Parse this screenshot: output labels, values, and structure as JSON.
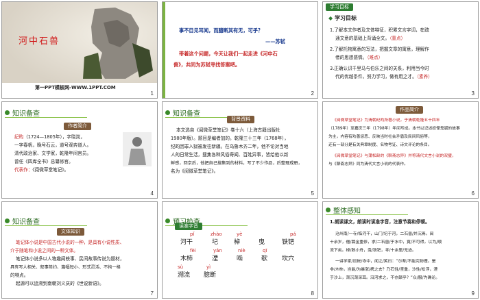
{
  "s1": {
    "title": "河中石兽",
    "footer": "第一PPT模板网-WWW.1PPT.COM",
    "num": "1"
  },
  "s2": {
    "quote": "事不目见耳闻，而臆断其有无，可乎？",
    "author": "——苏轼",
    "lead_a": "带着这个问题，今天让我们一起走进《河中石",
    "lead_b": "兽》，共同为苏轼寻找答案吧。",
    "num": "2"
  },
  "s3": {
    "tag": "学习目标",
    "head": "学习目标",
    "items": [
      {
        "n": "1.",
        "a": "了解本文作者及文体特征，积累文言字词，在疏",
        "b": "通文意的基础上背诵全文。",
        "em": "（重点）"
      },
      {
        "n": "2.",
        "a": "了解托物寓意的写法，把握文章的寓意，理解作",
        "b": "者的思想感情。",
        "em": "（难点）"
      },
      {
        "n": "3.",
        "a": "正确认识千里马与伯乐之间的关系，利用当今时",
        "b": "代的优越条件，努力学习，做有用之才。",
        "em": "（素养）"
      }
    ],
    "num": "3"
  },
  "s4": {
    "head": "知识备查",
    "tag": "作者简介",
    "name": "纪昀",
    "rest": "（1724—1805年），字晓岚，",
    "lines": [
      "一字春帆，晚号石云，道号观弈道人。",
      "清代政治家、文学家，乾隆年间官员。",
      "曾任《四库全书》总纂修官。"
    ],
    "rep_label": "代表作：",
    "rep": "《阅微草堂笔记》。",
    "num": "4"
  },
  "s5": {
    "head": "知识备查",
    "tag": "背景资料",
    "lines": [
      "本文选自《阅微草堂笔记》卷十六（上海古籍出版社",
      "1980年版）。题目是编者加的。乾隆三十三年（1768年），",
      "纪昀因罪入狱被发往新疆。在乌鲁木齐二年，他不论对当地",
      "人的日常生活，搜集各种风俗奇闻、百姓异事，皆给他以新",
      "鲜感，回京后，他把自己搜集到的材料，写了不少作品，后整理成册，",
      "名为《阅微草堂笔记》。"
    ],
    "num": "5"
  },
  "s6": {
    "tag": "作品简介",
    "lines": [
      "《阅微草堂笔记》为清朝纪昀所著小说，于清朝乾隆五十四年",
      "（1789年）至嘉庆三年（1798年）年间写成。本书以记述妖怪鬼狐的故事",
      "为主，内容有劝善惩恶、反映当时社会矛盾及民间风俗等，",
      "还有一部分是有关典章制度、名物考证、诗文评论的条目。",
      "《阅微草堂笔记》与蒲松龄的《聊斋志异》并称清代文言小说的双璧，",
      "与《聊斋志异》同为清代文言小说的代表作。"
    ],
    "num": "6"
  },
  "s7": {
    "head": "知识备查",
    "tag": "文体知识",
    "lines": [
      "笔记体小说是中国古代小说的一种，是具有小说性质、",
      "介于随笔和小说之间的一种文体。",
      "笔记体小说多以人物趣闻轶事、民间故事传说为题材，",
      "具有写人相关、叙事简约、篇幅短小、形式灵活、不拘一格",
      "的特点。",
      "起源可以追溯到南朝刘义庆的《世说新语》。"
    ],
    "num": "7"
  },
  "s8": {
    "head": "预习检查",
    "tag": "读准字音",
    "r1p": [
      "pǐ",
      "zhào",
      "yè",
      "pá"
    ],
    "r1c": [
      "河干",
      "圮",
      "棹",
      "曳",
      "铁钯"
    ],
    "r2p": [
      "fèi",
      "yán",
      "niè",
      "qī"
    ],
    "r2c": [
      "木柿",
      "湮",
      "啮",
      "欹",
      "坎穴"
    ],
    "r3p": [
      "sù",
      "yì"
    ],
    "r3c": [
      "溯流",
      "臆断"
    ],
    "num": "8"
  },
  "s9": {
    "head": "整体感知",
    "sub": "1.朗读课文，朗读时读准字音，注意节奏和停顿。",
    "lines": [
      "沧州南/一寺/临河干，山门/圮于河，二石兽/并沉焉。阅",
      "十余岁，僧/募金重修，求/二石兽/于水中，竟/不可得，以为/顺",
      "流下矣。棹/数小舟，曳/铁钯，寻/十余里/无迹。",
      "一讲学家/设帐/寺中，闻之/笑曰：“尔辈/不能究物理。是",
      "非/木柿，岂能/为暴涨/携之去？乃石性/坚重，沙性/松浮，湮",
      "于沙上，渐沉渐深耳。沿河求之，不亦颠乎？”众/服/为确论。"
    ],
    "num": "9"
  }
}
